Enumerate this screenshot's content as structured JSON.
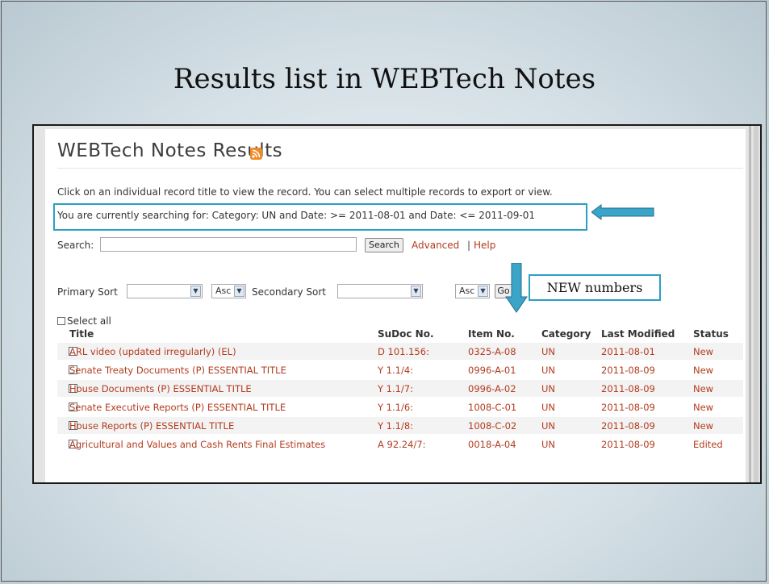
{
  "slide": {
    "title": "Results list in WEBTech Notes",
    "callout_new": "NEW numbers"
  },
  "app": {
    "title": "WEBTech Notes Results",
    "feed_icon": "rss-icon",
    "instruction": "Click on an individual record title to view the record. You can select multiple records to export or view.",
    "searching_text": "You are currently searching for: Category: UN and Date: >= 2011-08-01 and Date: <= 2011-09-01",
    "search": {
      "label": "Search:",
      "value": "",
      "button": "Search",
      "advanced": "Advanced",
      "separator": "|",
      "help": "Help"
    },
    "sort": {
      "primary_label": "Primary Sort",
      "primary_value": "",
      "primary_order": "Asc",
      "secondary_label": "Secondary Sort",
      "secondary_value": "",
      "secondary_order": "Asc",
      "go": "Go"
    },
    "select_all": "Select all",
    "columns": [
      "Title",
      "SuDoc No.",
      "Item No.",
      "Category",
      "Last Modified",
      "Status"
    ],
    "rows": [
      {
        "title": "ARL video (updated irregularly) (EL)",
        "sudoc": "D 101.156:",
        "item": "0325-A-08",
        "category": "UN",
        "modified": "2011-08-01",
        "status": "New"
      },
      {
        "title": "Senate Treaty Documents (P) ESSENTIAL TITLE",
        "sudoc": "Y 1.1/4:",
        "item": "0996-A-01",
        "category": "UN",
        "modified": "2011-08-09",
        "status": "New"
      },
      {
        "title": "House Documents (P) ESSENTIAL TITLE",
        "sudoc": "Y 1.1/7:",
        "item": "0996-A-02",
        "category": "UN",
        "modified": "2011-08-09",
        "status": "New"
      },
      {
        "title": "Senate Executive Reports (P) ESSENTIAL TITLE",
        "sudoc": "Y 1.1/6:",
        "item": "1008-C-01",
        "category": "UN",
        "modified": "2011-08-09",
        "status": "New"
      },
      {
        "title": "House Reports (P) ESSENTIAL TITLE",
        "sudoc": "Y 1.1/8:",
        "item": "1008-C-02",
        "category": "UN",
        "modified": "2011-08-09",
        "status": "New"
      },
      {
        "title": "Agricultural and Values and Cash Rents Final Estimates",
        "sudoc": "A 92.24/7:",
        "item": "0018-A-04",
        "category": "UN",
        "modified": "2011-08-09",
        "status": "Edited"
      }
    ]
  },
  "colors": {
    "link": "#b33b1e",
    "highlight_border": "#2d9fc4",
    "arrow_fill": "#3aa5c9"
  }
}
